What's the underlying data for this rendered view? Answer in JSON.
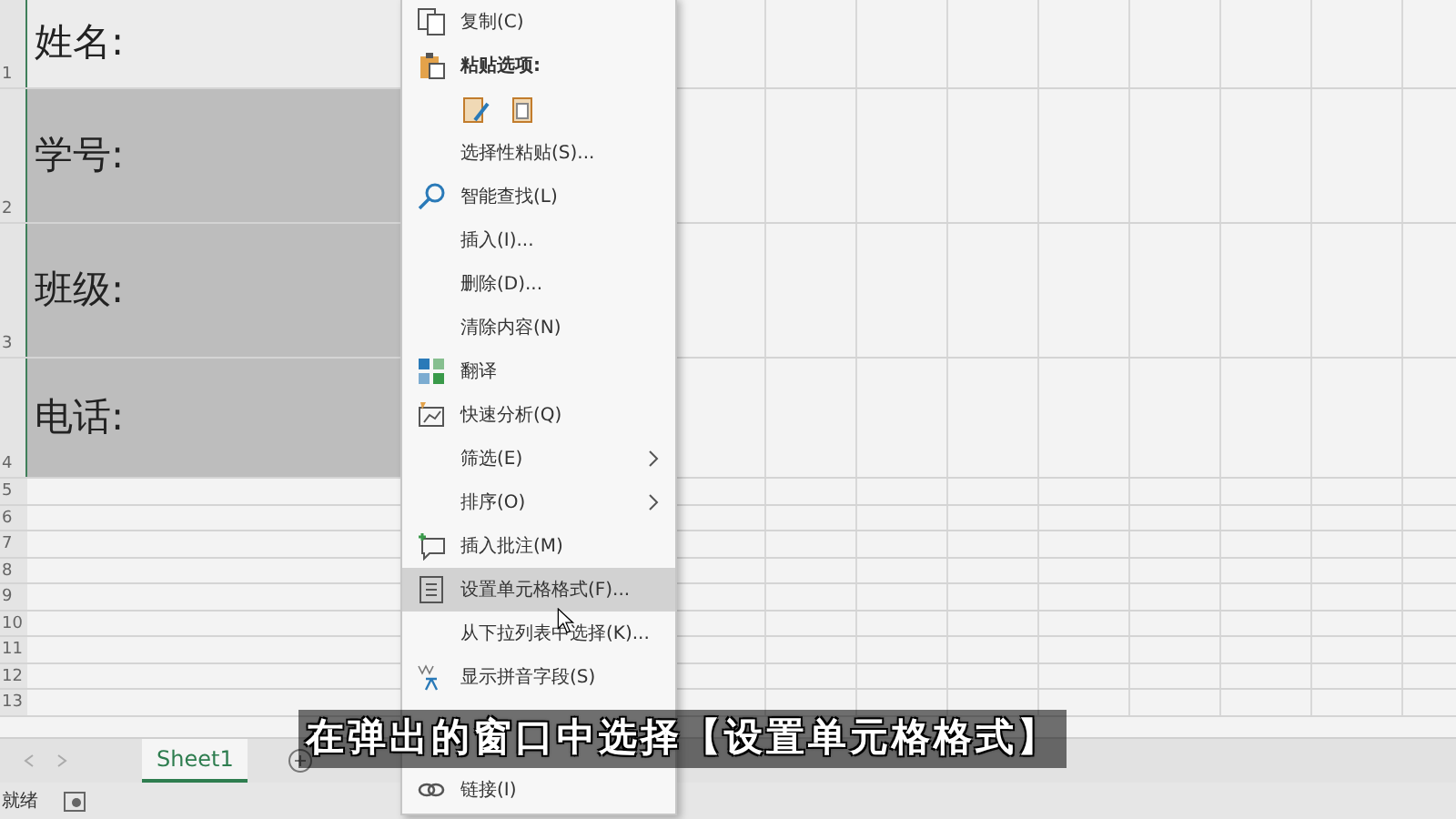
{
  "sheet": {
    "rows": [
      {
        "number": "1",
        "text": "姓名:",
        "selected": false
      },
      {
        "number": "2",
        "text": "学号:",
        "selected": true
      },
      {
        "number": "3",
        "text": "班级:",
        "selected": true
      },
      {
        "number": "4",
        "text": "电话:",
        "selected": true
      }
    ],
    "empty_rows": [
      "5",
      "6",
      "7",
      "8",
      "9",
      "10",
      "11",
      "12",
      "13"
    ]
  },
  "context_menu": {
    "items": [
      {
        "kind": "item",
        "label": "复制(C)",
        "selected": false
      },
      {
        "kind": "header",
        "label": "粘贴选项:",
        "selected": false
      },
      {
        "kind": "paste-options",
        "selected": false
      },
      {
        "kind": "item",
        "label": "选择性粘贴(S)...",
        "selected": false
      },
      {
        "kind": "item",
        "label": "智能查找(L)",
        "selected": false
      },
      {
        "kind": "item",
        "label": "插入(I)...",
        "selected": false
      },
      {
        "kind": "item",
        "label": "删除(D)...",
        "selected": false
      },
      {
        "kind": "item",
        "label": "清除内容(N)",
        "selected": false
      },
      {
        "kind": "item",
        "label": "翻译",
        "selected": false
      },
      {
        "kind": "item",
        "label": "快速分析(Q)",
        "selected": false
      },
      {
        "kind": "submenu",
        "label": "筛选(E)",
        "selected": false
      },
      {
        "kind": "submenu",
        "label": "排序(O)",
        "selected": false
      },
      {
        "kind": "item",
        "label": "插入批注(M)",
        "selected": false
      },
      {
        "kind": "item",
        "label": "设置单元格格式(F)...",
        "selected": true
      },
      {
        "kind": "item",
        "label": "从下拉列表中选择(K)...",
        "selected": false
      },
      {
        "kind": "item",
        "label": "显示拼音字段(S)",
        "selected": false
      },
      {
        "kind": "covered"
      },
      {
        "kind": "item",
        "label": "链接(I)",
        "selected": false
      }
    ]
  },
  "sheet_tabs": [
    {
      "label": "Sheet1",
      "selected": true
    }
  ],
  "status_bar": {
    "text": "就绪"
  },
  "subtitle": "在弹出的窗口中选择【设置单元格格式】"
}
